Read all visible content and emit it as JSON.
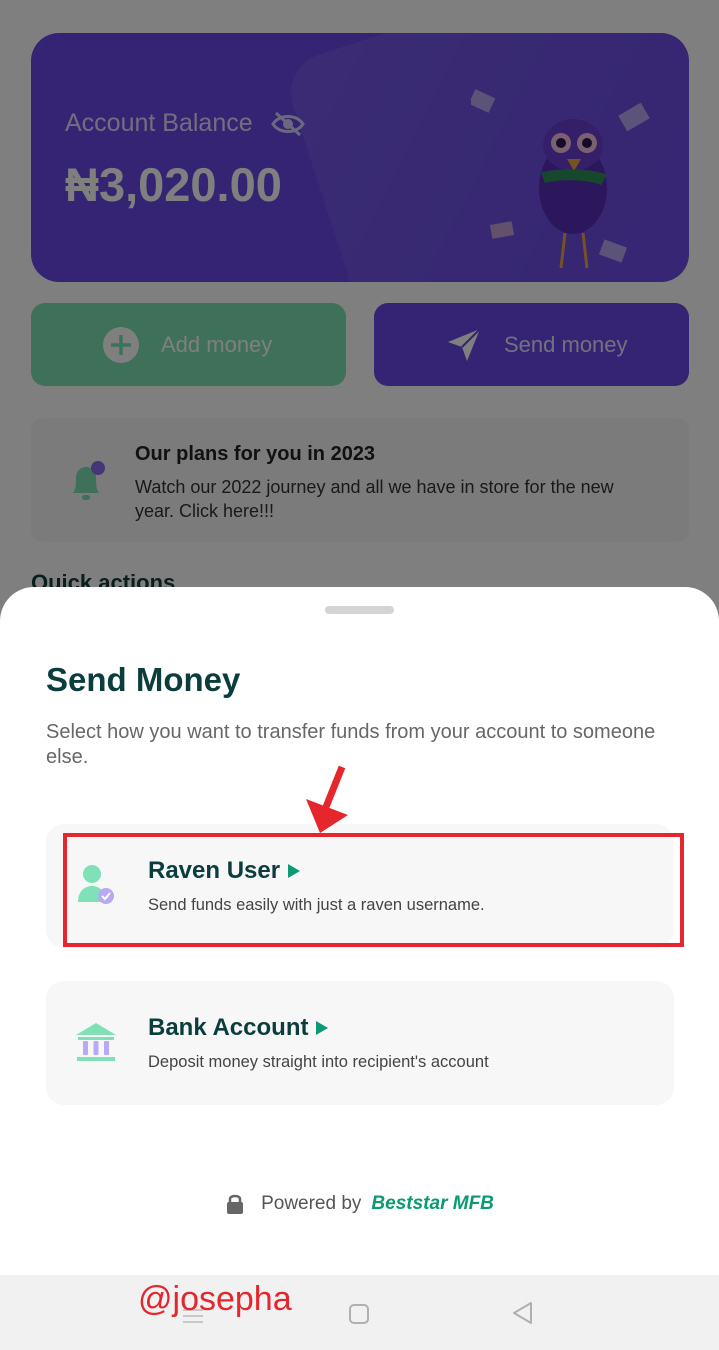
{
  "balance_card": {
    "label": "Account Balance",
    "amount": "₦3,020.00",
    "eye_icon": "eye-slash-icon"
  },
  "actions": {
    "add_money": "Add money",
    "send_money": "Send money"
  },
  "plans_card": {
    "title": "Our plans for you in 2023",
    "description": "Watch our 2022 journey and all we have in store for the new year. Click here!!!"
  },
  "quick_actions_label": "Quick actions",
  "sheet": {
    "title": "Send Money",
    "subtitle": "Select how you want to transfer funds from your account to someone else.",
    "options": [
      {
        "title": "Raven User",
        "description": "Send funds easily with just a raven username.",
        "icon": "verified-user-icon"
      },
      {
        "title": "Bank Account",
        "description": "Deposit money straight into recipient's account",
        "icon": "bank-icon"
      }
    ],
    "powered_by": "Powered by",
    "brand": "Beststar MFB"
  },
  "watermark": "@josepha",
  "colors": {
    "primary_purple": "#6a49e6",
    "accent_green": "#0b9a73",
    "title_teal": "#0c3d3d",
    "highlight_red": "#e5262c"
  }
}
